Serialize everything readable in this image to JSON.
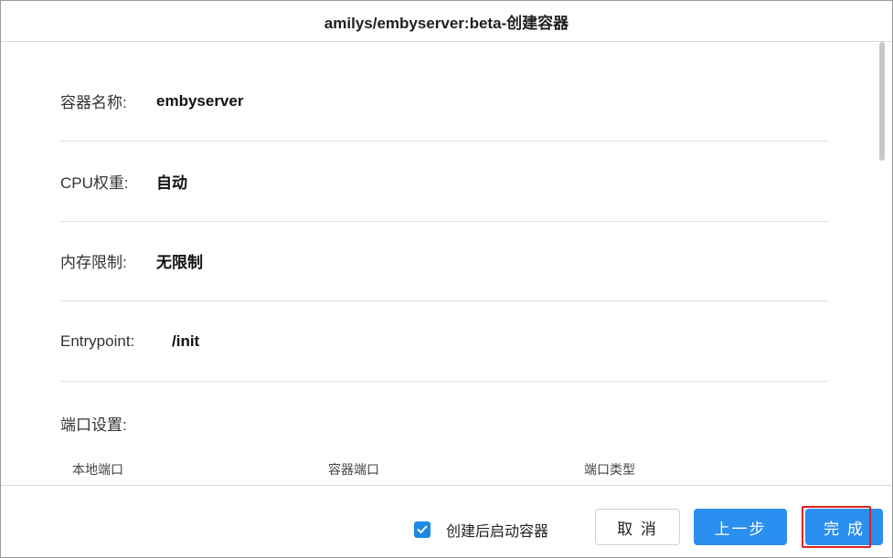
{
  "dialog": {
    "title": "amilys/embyserver:beta-创建容器"
  },
  "summary": {
    "rows": [
      {
        "label": "容器名称:",
        "value": "embyserver"
      },
      {
        "label": "CPU权重:",
        "value": "自动"
      },
      {
        "label": "内存限制:",
        "value": "无限制"
      },
      {
        "label": "Entrypoint:",
        "value": "/init"
      }
    ],
    "port_section_label": "端口设置:",
    "port_columns": [
      "本地端口",
      "容器端口",
      "端口类型"
    ]
  },
  "footer": {
    "start_after_create_label": "创建后启动容器",
    "start_after_create_checked": true,
    "cancel_label": "取 消",
    "prev_label": "上一步",
    "done_label": "完 成"
  },
  "colors": {
    "primary": "#2b8ff0",
    "highlight_outline": "#e02020"
  }
}
